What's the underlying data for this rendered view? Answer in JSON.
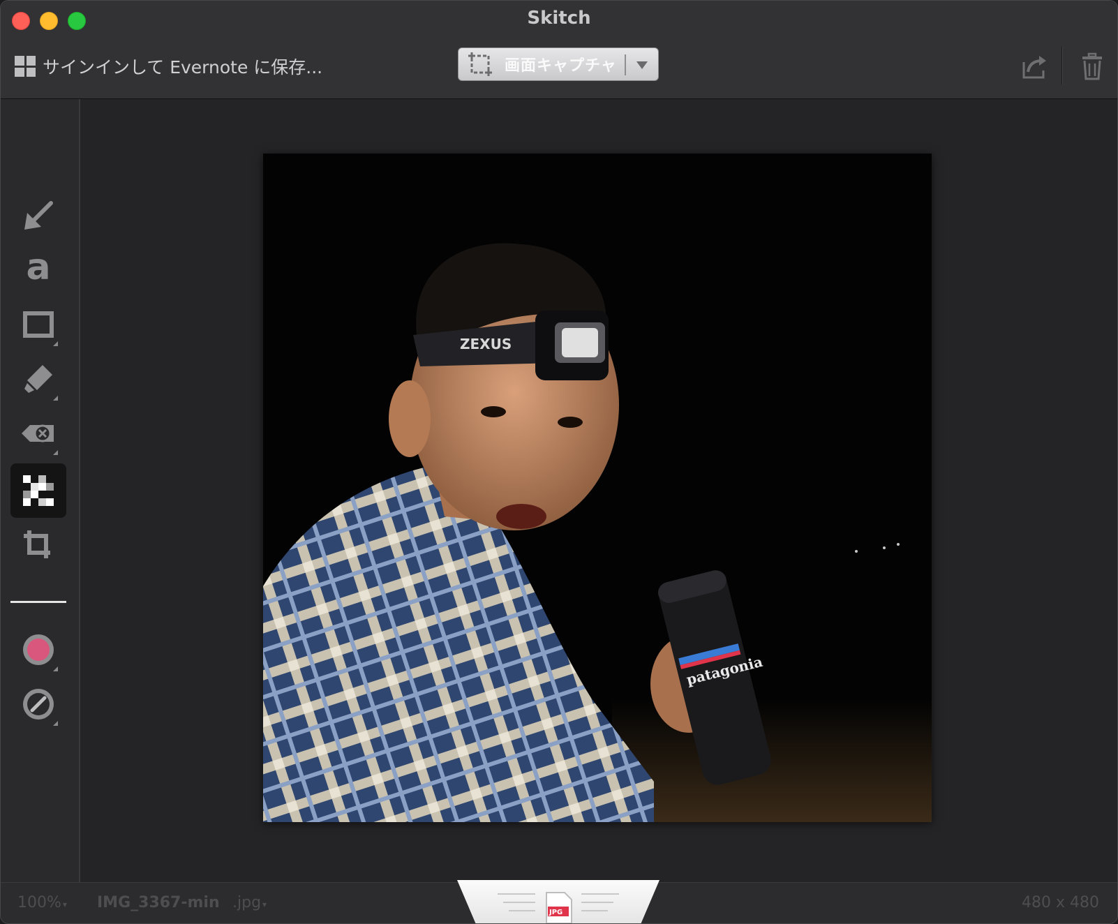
{
  "window": {
    "title": "Skitch"
  },
  "toolbar": {
    "signin_label": "サインインして Evernote に保存...",
    "capture_label": "画面キャプチャ"
  },
  "tools": [
    {
      "name": "arrow-tool",
      "icon": "arrow-icon"
    },
    {
      "name": "text-tool",
      "icon": "text-icon",
      "glyph": "a"
    },
    {
      "name": "rectangle-tool",
      "icon": "rectangle-icon"
    },
    {
      "name": "highlighter-tool",
      "icon": "highlighter-icon"
    },
    {
      "name": "stamp-tool",
      "icon": "stamp-icon"
    },
    {
      "name": "pixelate-tool",
      "icon": "pixelate-icon",
      "active": true
    },
    {
      "name": "crop-tool",
      "icon": "crop-icon"
    },
    {
      "name": "color-picker",
      "icon": "color-swatch-icon",
      "color": "#d9577c"
    },
    {
      "name": "line-width-picker",
      "icon": "line-width-icon"
    }
  ],
  "colors": {
    "accent_color": "#d9577c",
    "active_tool_bg": "#141414"
  },
  "status": {
    "zoom": "100%",
    "filename": "IMG_3367-min",
    "extension": ".jpg",
    "dimensions": "480 x 480",
    "file_badge": "JPG"
  },
  "photo": {
    "headlamp_brand": "ZEXUS",
    "bottle_brand": "patagonia"
  }
}
